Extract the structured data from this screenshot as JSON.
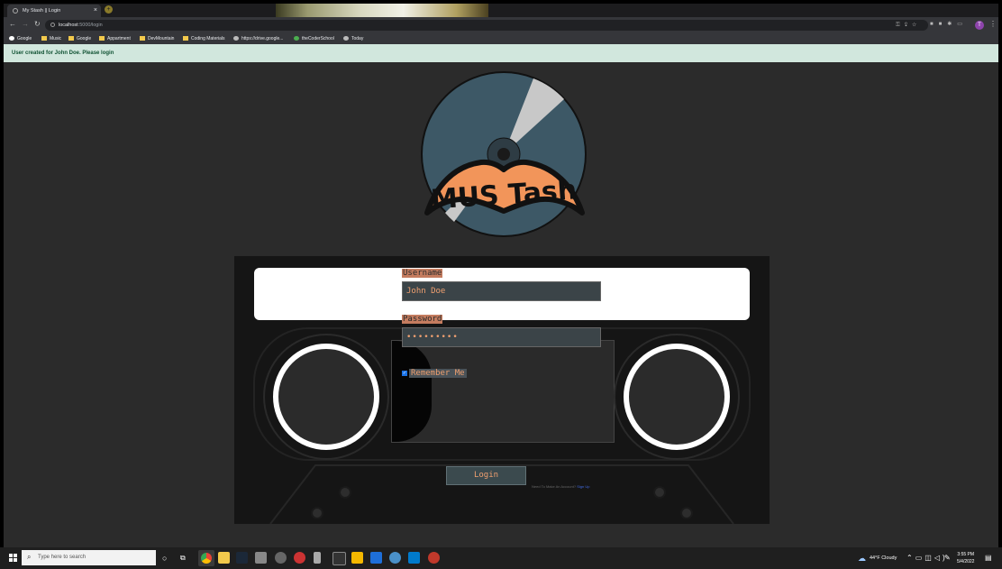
{
  "browser": {
    "tab_title": "My Stash || Login",
    "tab_close": "×",
    "new_tab": "+",
    "url_host": "localhost",
    "url_path": ":5000/login",
    "bookmarks": [
      {
        "label": "Google",
        "icon": "google-icon"
      },
      {
        "label": "Music",
        "icon": "folder-icon"
      },
      {
        "label": "Google",
        "icon": "folder-icon"
      },
      {
        "label": "Appartment",
        "icon": "folder-icon"
      },
      {
        "label": "DevMountain",
        "icon": "folder-icon"
      },
      {
        "label": "Coding Materials",
        "icon": "folder-icon"
      },
      {
        "label": "https://drive.google...",
        "icon": "drive-icon"
      },
      {
        "label": "theCoderSchool",
        "icon": "dot-icon"
      },
      {
        "label": "Today",
        "icon": "link-icon"
      }
    ],
    "profile_initial": "T"
  },
  "flash": {
    "message": "User created for John Doe. Please login"
  },
  "logo": {
    "text": "MUS Tash",
    "colors": {
      "disc": "#3d5866",
      "stache": "#f2955a",
      "glare": "#c8c8c8"
    }
  },
  "form": {
    "username_label": "Username",
    "username_value": "John Doe",
    "password_label": "Password",
    "password_value": "•••••••••",
    "remember_label": "Remember Me",
    "remember_checked": true,
    "login_button": "Login",
    "signup_prompt": "Need To Make An Account?",
    "signup_link": "Sign Up"
  },
  "taskbar": {
    "search_placeholder": "Type here to search",
    "weather": "44°F  Cloudy",
    "time": "3:55 PM",
    "date": "5/4/2022",
    "apps": [
      "chrome-icon",
      "steam-icon",
      "explorer-icon",
      "github-icon",
      "app-icon",
      "vscode-icon",
      "chrome-icon"
    ]
  },
  "colors": {
    "accent": "#f0a070",
    "flash_bg": "#d1e7dd",
    "page_bg": "#2b2b2b"
  }
}
